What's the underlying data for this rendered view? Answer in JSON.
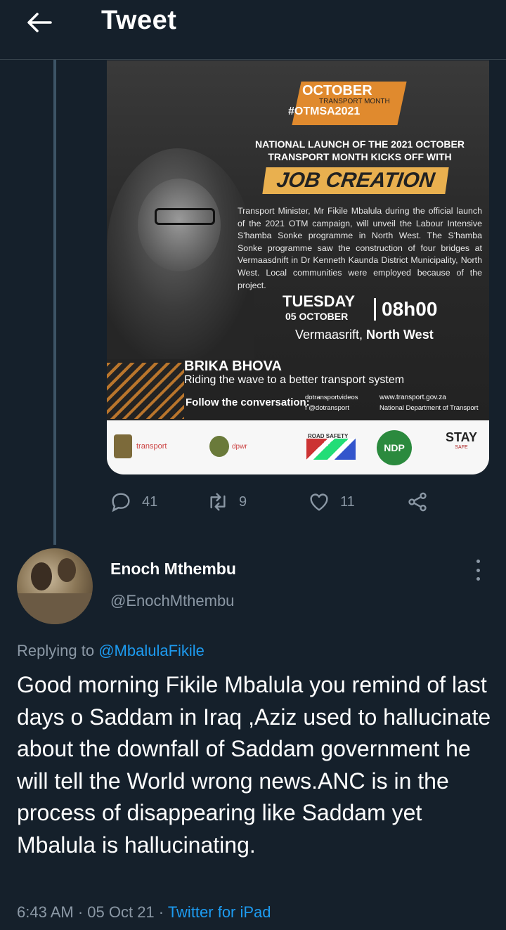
{
  "header": {
    "title": "Tweet"
  },
  "icons": {
    "back": "arrow-left-icon",
    "reply": "reply-icon",
    "retweet": "retweet-icon",
    "like": "heart-icon",
    "share": "share-icon",
    "more": "more-vertical-icon"
  },
  "colors": {
    "background": "#15202b",
    "accent": "#1d9bf0",
    "secondary_text": "#8b98a5"
  },
  "poster": {
    "otm_title": "OCTOBER",
    "otm_subtitle": "TRANSPORT MONTH",
    "otm_hashtag": "#OTMSA2021",
    "headline": "NATIONAL LAUNCH OF THE 2021 OCTOBER TRANSPORT MONTH KICKS OFF WITH",
    "job_creation": "JOB CREATION",
    "body": "Transport Minister, Mr Fikile Mbalula during the official launch of the 2021 OTM campaign, will unveil the Labour Intensive S'hamba Sonke programme in North West. The S'hamba Sonke programme saw the construction of four bridges at Vermaasdnift in Dr Kenneth Kaunda District Municipality, North West. Local communities were employed because of the project.",
    "day": "TUESDAY",
    "date": "05 OCTOBER",
    "time": "08h00",
    "venue_plain": "Vermaasrift, ",
    "venue_bold": "North West",
    "brika": "BRIKA BHOVA",
    "riding": "Riding the wave to a better transport system",
    "follow": "Follow the conversation:",
    "social_youtube": "dotransportvideos",
    "social_web": "www.transport.gov.za",
    "social_twitter": "f  @dotransport",
    "social_linkedin": "National Department of Transport",
    "logo_transport": "transport",
    "logo_dpwr": "dpwr",
    "logo_roadsafety": "ROAD SAFETY",
    "logo_ndp": "NDP",
    "logo_stay": "STAY",
    "logo_safe": "SAFE"
  },
  "actions": {
    "replies": "41",
    "retweets": "9",
    "likes": "11"
  },
  "reply": {
    "display_name": "Enoch Mthembu",
    "handle": "@EnochMthembu",
    "replying_prefix": "Replying to ",
    "replying_to": "@MbalulaFikile",
    "text": "Good morning Fikile Mbalula you remind of last days o Saddam in Iraq ,Aziz used to hallucinate about the downfall of Saddam government he will tell the World wrong news.ANC is in the process of disappearing like Saddam yet Mbalula is hallucinating.",
    "time": "6:43 AM · 05 Oct 21 · ",
    "source": "Twitter for iPad"
  }
}
